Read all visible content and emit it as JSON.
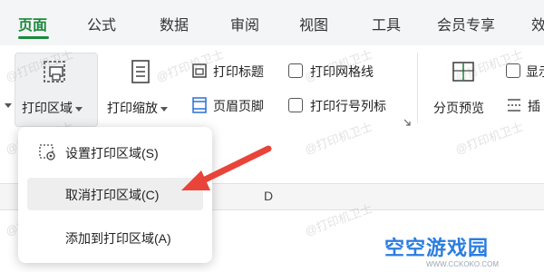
{
  "tabs": [
    {
      "label": "页面",
      "active": true
    },
    {
      "label": "公式"
    },
    {
      "label": "数据"
    },
    {
      "label": "审阅"
    },
    {
      "label": "视图"
    },
    {
      "label": "工具"
    },
    {
      "label": "会员专享"
    },
    {
      "label": "效"
    }
  ],
  "ribbon": {
    "print_area": "打印区域",
    "print_scale": "打印缩放",
    "print_title": "打印标题",
    "header_footer": "页眉页脚",
    "print_gridlines": "打印网格线",
    "print_row_col_headers": "打印行号列标",
    "page_break_preview": "分页预览",
    "show_partial": "显示",
    "insert_partial": "插"
  },
  "menu": {
    "items": [
      {
        "label": "设置打印区域(S)"
      },
      {
        "label": "取消打印区域(C)",
        "hovered": true
      },
      {
        "label": "添加到打印区域(A)"
      }
    ]
  },
  "sheet": {
    "columns": [
      "D"
    ]
  },
  "watermark": "@打印机卫士",
  "logo": {
    "name": "空空游戏园",
    "url": "WWW.CCKOKO.COM"
  },
  "colors": {
    "accent": "#1a8a3a",
    "arrow": "#e8443a",
    "logo_blue": "#2a7de1"
  }
}
